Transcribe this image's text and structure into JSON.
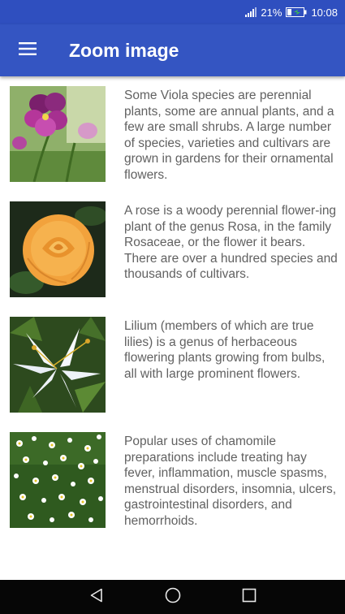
{
  "status_bar": {
    "battery_percent": "21%",
    "time": "10:08",
    "icons": [
      "signal-icon",
      "battery-icon"
    ]
  },
  "app_bar": {
    "title": "Zoom image",
    "menu_icon": "hamburger-menu-icon"
  },
  "items": [
    {
      "image": "viola-flower-image",
      "text": "Some Viola species are perennial plants, some are annual plants, and a few are small shrubs. A large number of species, varieties and cultivars are grown in gardens for their ornamental flowers."
    },
    {
      "image": "rose-flower-image",
      "text": "A rose is a woody perennial flower-ing plant of the genus Rosa, in the family Rosaceae, or the flower it bears. There are over a hundred species and thousands of cultivars."
    },
    {
      "image": "lily-flower-image",
      "text": "Lilium (members of which are true lilies) is a genus of herbaceous flowering plants growing from bulbs, all with large prominent flowers."
    },
    {
      "image": "chamomile-flower-image",
      "text": " Popular uses of chamomile preparations include treating hay fever, inflammation, muscle spasms, menstrual disorders, insomnia, ulcers, gastrointestinal disorders, and hemorrhoids."
    }
  ],
  "nav_bar": {
    "icons": [
      "back-icon",
      "home-icon",
      "recents-icon"
    ]
  },
  "colors": {
    "status_bar": "#2f4fbf",
    "app_bar": "#3455c2",
    "text": "#616161",
    "nav_bar": "#060606"
  }
}
